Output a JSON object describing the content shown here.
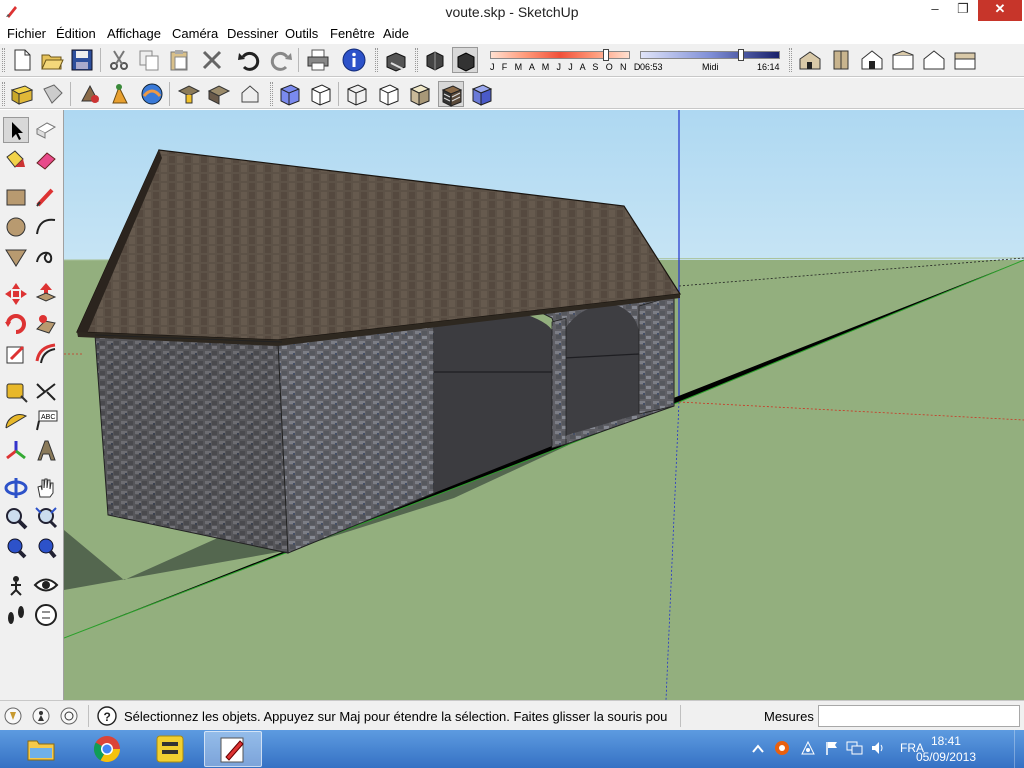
{
  "window": {
    "title": "voute.skp - SketchUp",
    "minimize": "–",
    "restore": "❐",
    "close": "✕"
  },
  "menu": [
    "Fichier",
    "Édition",
    "Affichage",
    "Caméra",
    "Dessiner",
    "Outils",
    "Fenêtre",
    "Aide"
  ],
  "shadow_settings": {
    "months": "J F M A M J J A S O N D",
    "time_start": "06:53",
    "time_mid": "Midi",
    "time_end": "16:14"
  },
  "statusbar": {
    "message": "Sélectionnez les objets. Appuyez sur Maj pour étendre la sélection. Faites glisser la souris pou",
    "measure_label": "Mesures",
    "measure_value": ""
  },
  "taskbar": {
    "language": "FRA",
    "time": "18:41",
    "date": "05/09/2013"
  },
  "colors": {
    "sky": "#b8dcf2",
    "ground": "#94b080",
    "roof": "#5e5348",
    "wall": "#5b5b5e",
    "taskbar": "#3571c4"
  },
  "icons": {
    "toolbar1": [
      "new-icon",
      "open-icon",
      "save-icon",
      "cut-icon",
      "copy-icon",
      "erase-icon",
      "undo-icon",
      "redo-icon",
      "print-icon",
      "model-info-icon",
      "shadows-toggle-icon",
      "shadow-settings-icon",
      "fog-icon"
    ],
    "toolbar1_right": [
      "iso-view-icon",
      "top-view-icon",
      "front-view-icon",
      "right-view-icon",
      "back-view-icon",
      "left-view-icon"
    ],
    "toolbar2": [
      "component-icon",
      "paint-bucket-icon",
      "add-location-icon",
      "get-models-icon",
      "share-model-icon",
      "sandbox-icon",
      "photo-texture-icon",
      "make-component-icon",
      "xray-icon",
      "back-edges-icon",
      "wireframe-icon",
      "hidden-line-icon",
      "shaded-icon",
      "shaded-textures-icon",
      "monochrome-icon"
    ],
    "left": [
      "select-icon",
      "make-component-icon",
      "paint-bucket-icon",
      "eraser-icon",
      "rectangle-icon",
      "line-icon",
      "circle-icon",
      "arc-icon",
      "polygon-icon",
      "freehand-icon",
      "move-icon",
      "push-pull-icon",
      "rotate-icon",
      "follow-me-icon",
      "scale-icon",
      "offset-icon",
      "tape-measure-icon",
      "dimension-icon",
      "protractor-icon",
      "text-icon",
      "axes-icon",
      "3d-text-icon",
      "orbit-icon",
      "pan-icon",
      "zoom-icon",
      "zoom-window-icon",
      "zoom-extents-icon",
      "previous-view-icon",
      "position-camera-icon",
      "look-around-icon",
      "walk-icon",
      "section-plane-icon"
    ]
  }
}
